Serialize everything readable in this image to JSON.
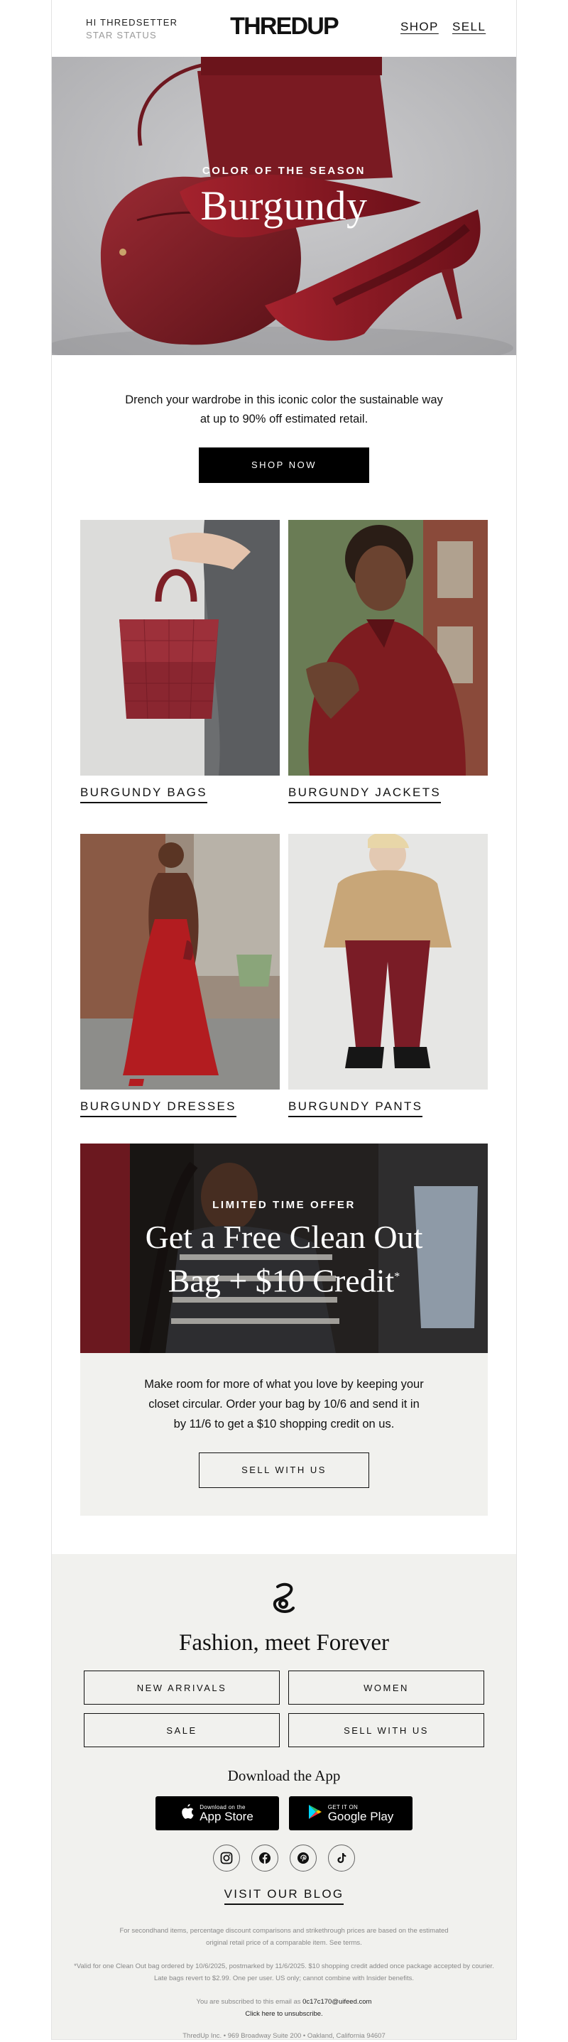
{
  "header": {
    "greeting": "HI THREDSETTER",
    "status": "STAR STATUS",
    "logo": "THREDUP",
    "nav_shop": "SHOP",
    "nav_sell": "SELL"
  },
  "hero": {
    "eyebrow": "COLOR OF THE SEASON",
    "title": "Burgundy"
  },
  "intro": {
    "text": "Drench your wardrobe in this iconic color the sustainable way at up to 90% off estimated retail.",
    "cta": "SHOP NOW"
  },
  "categories": [
    {
      "label": "BURGUNDY BAGS"
    },
    {
      "label": "BURGUNDY JACKETS"
    },
    {
      "label": "BURGUNDY DRESSES"
    },
    {
      "label": "BURGUNDY PANTS"
    }
  ],
  "promo": {
    "eyebrow": "LIMITED TIME OFFER",
    "title_line1": "Get a Free Clean Out",
    "title_line2": "Bag + $10 Credit",
    "title_mark": "*",
    "body": "Make room for more of what you love by keeping your closet circular. Order your bag by 10/6 and send it in by 11/6 to get a $10 shopping credit on us.",
    "cta": "SELL WITH US"
  },
  "footer": {
    "tagline": "Fashion, meet Forever",
    "links": [
      "NEW ARRIVALS",
      "WOMEN",
      "SALE",
      "SELL WITH US"
    ],
    "download_title": "Download the App",
    "app_store_small": "Download on the",
    "app_store_big": "App Store",
    "google_small": "GET IT ON",
    "google_big": "Google Play",
    "blog": "VISIT OUR BLOG",
    "fine_pricing": "For secondhand items, percentage discount comparisons and strikethrough prices are based on the estimated original retail price of a comparable item. See terms.",
    "fine_offer": "*Valid for one Clean Out bag ordered by 10/6/2025, postmarked by 11/6/2025. $10 shopping credit added once package accepted by courier. Late bags revert to $2.99. One per user. US only; cannot combine with Insider benefits.",
    "subscribed_prefix": "You are subscribed to this email as",
    "email": "0c17c170@uifeed.com",
    "unsubscribe": "Click here to unsubscribe.",
    "address": "ThredUp Inc. • 969 Broadway Suite 200 • Oakland, California 94607"
  },
  "colors": {
    "burgundy": "#7c1d24",
    "footer_bg": "#f1f1ee",
    "button_dark": "#000000"
  }
}
